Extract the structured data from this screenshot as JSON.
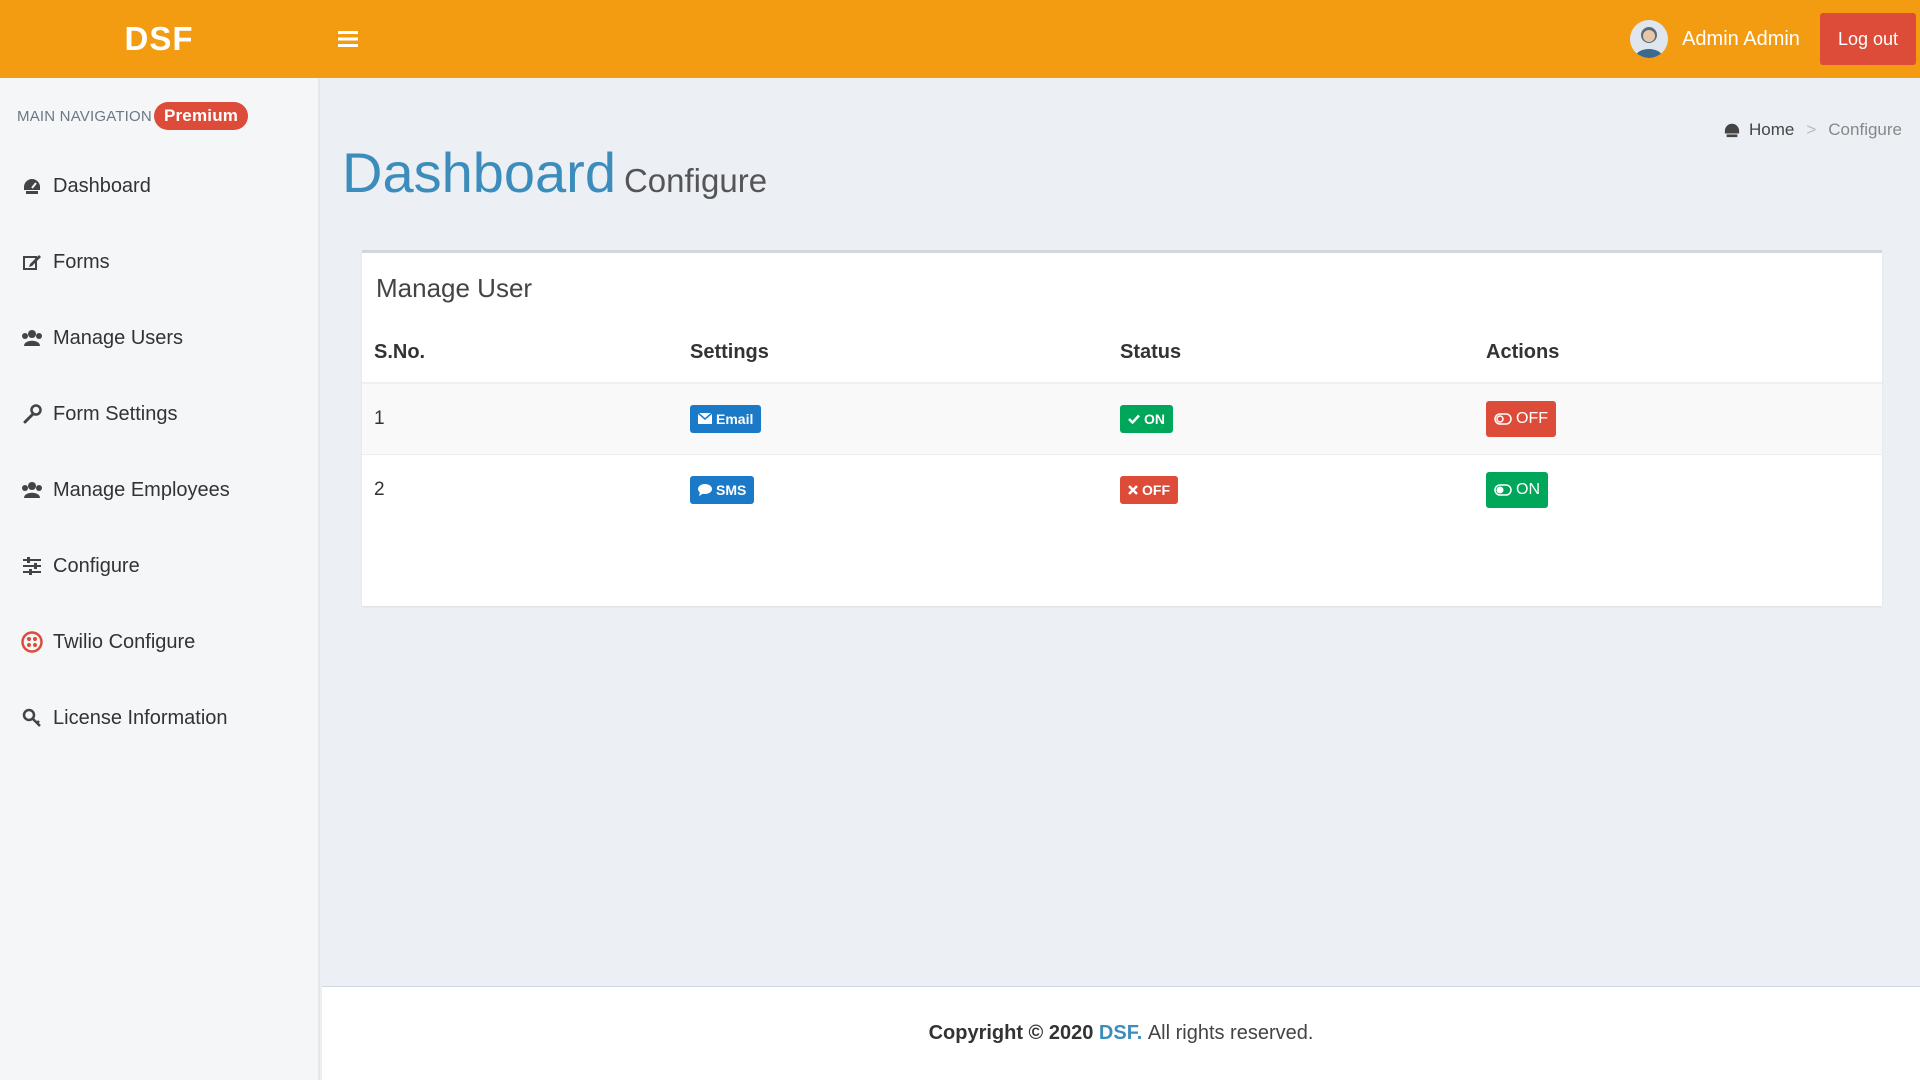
{
  "header": {
    "logo": "DSF",
    "user_name": "Admin Admin",
    "logout_label": "Log out"
  },
  "sidebar": {
    "nav_header": "MAIN NAVIGATION",
    "premium_badge": "Premium",
    "items": [
      {
        "label": "Dashboard",
        "icon": "dashboard-icon"
      },
      {
        "label": "Forms",
        "icon": "edit-icon"
      },
      {
        "label": "Manage Users",
        "icon": "users-icon"
      },
      {
        "label": "Form Settings",
        "icon": "wrench-icon"
      },
      {
        "label": "Manage Employees",
        "icon": "users-icon"
      },
      {
        "label": "Configure",
        "icon": "sliders-icon"
      },
      {
        "label": "Twilio Configure",
        "icon": "twilio-icon"
      },
      {
        "label": "License Information",
        "icon": "key-icon"
      }
    ]
  },
  "page": {
    "title": "Dashboard",
    "subtitle": "Configure"
  },
  "breadcrumb": {
    "home": "Home",
    "separator": ">",
    "current": "Configure"
  },
  "box": {
    "title": "Manage User",
    "columns": [
      "S.No.",
      "Settings",
      "Status",
      "Actions"
    ],
    "rows": [
      {
        "sno": "1",
        "setting": "Email",
        "status": "ON",
        "action": "OFF"
      },
      {
        "sno": "2",
        "setting": "SMS",
        "status": "OFF",
        "action": "ON"
      }
    ]
  },
  "footer": {
    "copyright": "Copyright © 2020",
    "brand": "DSF.",
    "rights": "All rights reserved."
  },
  "colors": {
    "header": "#f39c12",
    "primary": "#3c8dbc",
    "success": "#00a65a",
    "danger": "#dd4b39",
    "info_badge": "#1a7ac7"
  }
}
